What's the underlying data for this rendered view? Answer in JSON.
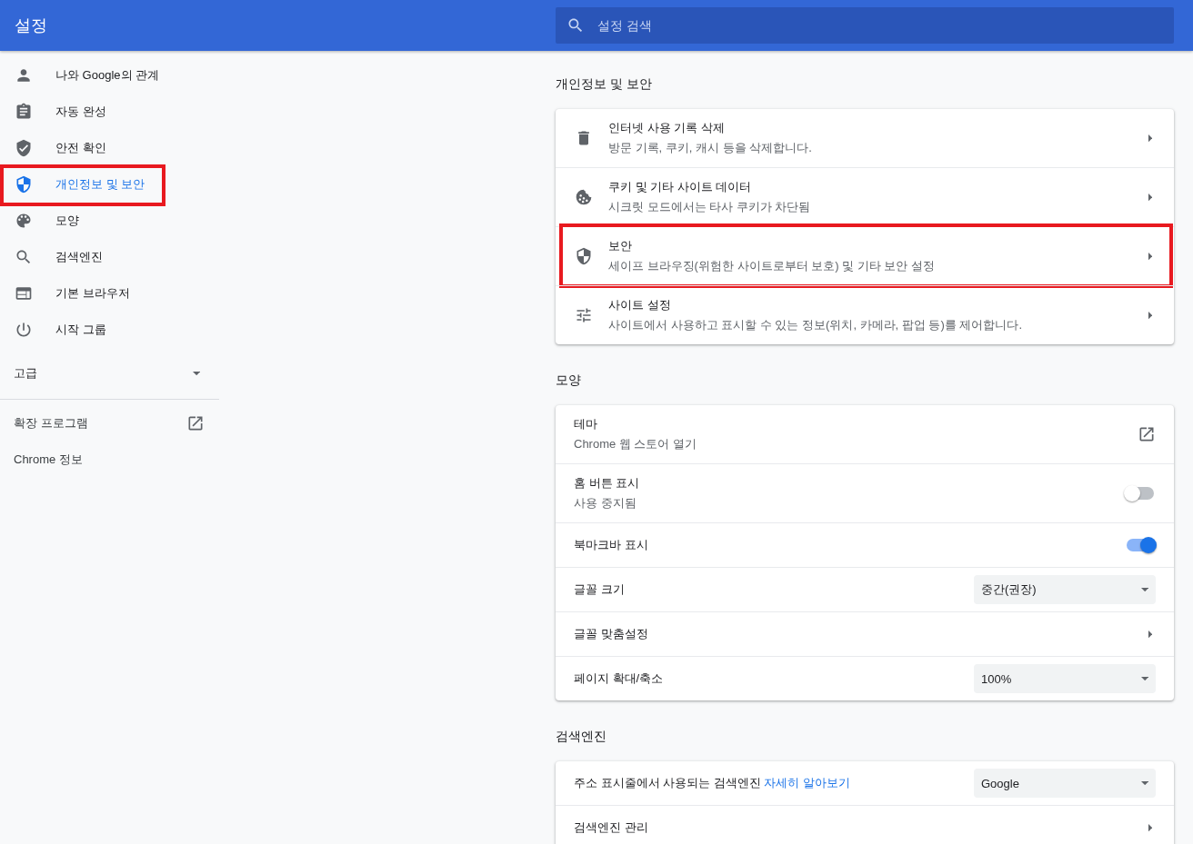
{
  "header": {
    "title": "설정",
    "search": {
      "placeholder": "설정 검색"
    }
  },
  "sidebar": {
    "items": [
      {
        "label": "나와 Google의 관계",
        "selected": false,
        "highlighted": false
      },
      {
        "label": "자동 완성",
        "selected": false,
        "highlighted": false
      },
      {
        "label": "안전 확인",
        "selected": false,
        "highlighted": false
      },
      {
        "label": "개인정보 및 보안",
        "selected": true,
        "highlighted": true
      },
      {
        "label": "모양",
        "selected": false,
        "highlighted": false
      },
      {
        "label": "검색엔진",
        "selected": false,
        "highlighted": false
      },
      {
        "label": "기본 브라우저",
        "selected": false,
        "highlighted": false
      },
      {
        "label": "시작 그룹",
        "selected": false,
        "highlighted": false
      }
    ],
    "advanced": {
      "label": "고급",
      "expanded": false
    },
    "links": [
      {
        "label": "확장 프로그램",
        "external": true
      },
      {
        "label": "Chrome 정보",
        "external": false
      }
    ]
  },
  "sections": [
    {
      "title": "개인정보 및 보안",
      "rows": [
        {
          "kind": "nav",
          "title": "인터넷 사용 기록 삭제",
          "subtitle": "방문 기록, 쿠키, 캐시 등을 삭제합니다.",
          "highlighted": false
        },
        {
          "kind": "nav",
          "title": "쿠키 및 기타 사이트 데이터",
          "subtitle": "시크릿 모드에서는 타사 쿠키가 차단됨",
          "highlighted": false
        },
        {
          "kind": "nav",
          "title": "보안",
          "subtitle": "세이프 브라우징(위험한 사이트로부터 보호) 및 기타 보안 설정",
          "highlighted": true
        },
        {
          "kind": "nav",
          "title": "사이트 설정",
          "subtitle": "사이트에서 사용하고 표시할 수 있는 정보(위치, 카메라, 팝업 등)를 제어합니다.",
          "highlighted": false
        }
      ]
    },
    {
      "title": "모양",
      "rows": [
        {
          "kind": "external",
          "title": "테마",
          "subtitle": "Chrome 웹 스토어 열기"
        },
        {
          "kind": "toggle",
          "title": "홈 버튼 표시",
          "subtitle": "사용 중지됨",
          "on": false
        },
        {
          "kind": "toggle",
          "title": "북마크바 표시",
          "on": true
        },
        {
          "kind": "select",
          "title": "글꼴 크기",
          "value": "중간(권장)"
        },
        {
          "kind": "nav",
          "title": "글꼴 맞춤설정"
        },
        {
          "kind": "select",
          "title": "페이지 확대/축소",
          "value": "100%"
        }
      ]
    },
    {
      "title": "검색엔진",
      "rows": [
        {
          "kind": "select",
          "title": "주소 표시줄에서 사용되는 검색엔진",
          "link": "자세히 알아보기",
          "value": "Google"
        },
        {
          "kind": "nav",
          "title": "검색엔진 관리"
        }
      ]
    }
  ]
}
